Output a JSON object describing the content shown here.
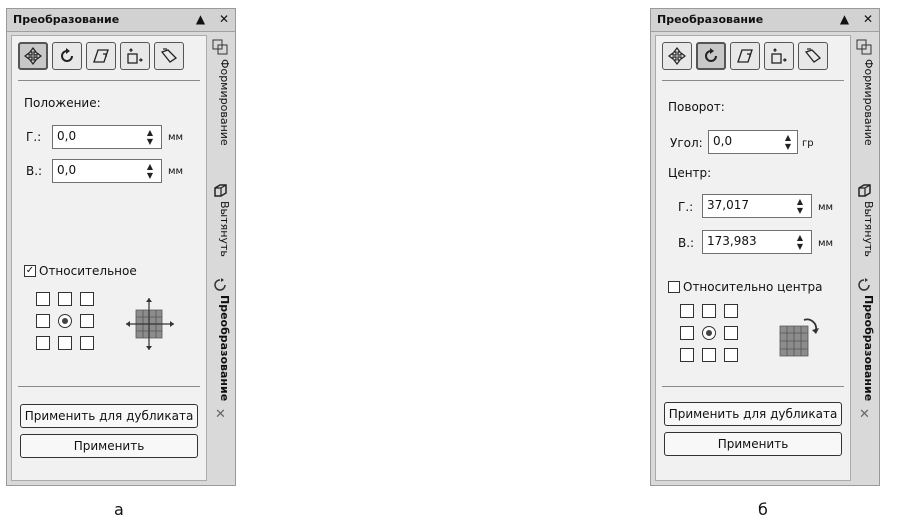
{
  "captions": {
    "a": "а",
    "b": "б"
  },
  "panel_a": {
    "title": "Преобразование",
    "collapse_icon": "▲",
    "close_icon": "✕",
    "section": "Положение:",
    "h_label": "Г.:",
    "h_value": "0,0",
    "h_unit": "мм",
    "v_label": "В.:",
    "v_value": "0,0",
    "v_unit": "мм",
    "relative_label": "Относительное",
    "relative_checked": "✓",
    "duplicate_button": "Применить для дубликата",
    "apply_button": "Применить",
    "tabs": {
      "shaping": "Формирование",
      "extrude": "Вытянуть",
      "transform": "Преобразование",
      "close": "✕"
    }
  },
  "panel_b": {
    "title": "Преобразование",
    "collapse_icon": "▲",
    "close_icon": "✕",
    "rotation_section": "Поворот:",
    "angle_label": "Угол:",
    "angle_value": "0,0",
    "angle_unit": "гр",
    "center_section": "Центр:",
    "h_label": "Г.:",
    "h_value": "37,017",
    "h_unit": "мм",
    "v_label": "В.:",
    "v_value": "173,983",
    "v_unit": "мм",
    "relative_label": "Относительно центра",
    "duplicate_button": "Применить для дубликата",
    "apply_button": "Применить",
    "tabs": {
      "shaping": "Формирование",
      "extrude": "Вытянуть",
      "transform": "Преобразование",
      "close": "✕"
    }
  }
}
